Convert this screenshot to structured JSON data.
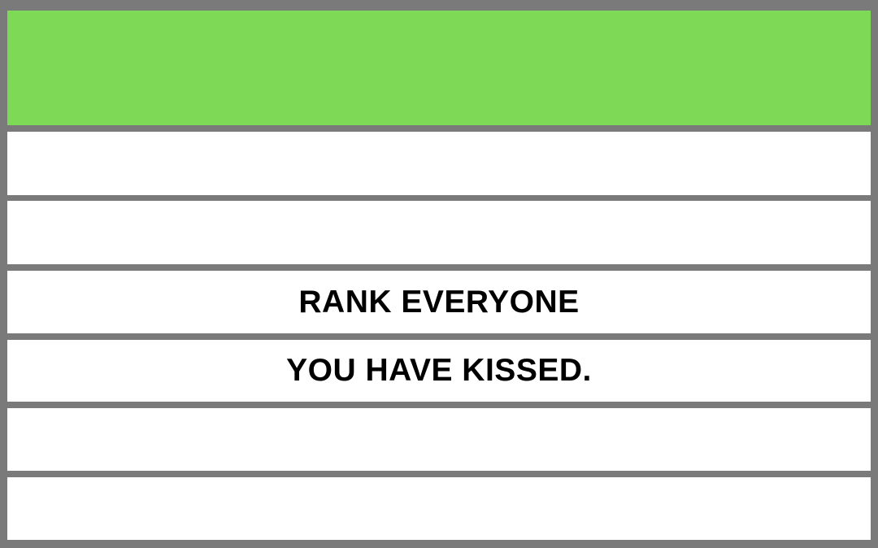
{
  "colors": {
    "border": "#7a7a7a",
    "header_fill": "#7ed957",
    "row_fill": "#ffffff",
    "text": "#000000"
  },
  "rows": [
    {
      "text": ""
    },
    {
      "text": ""
    },
    {
      "text": ""
    },
    {
      "text": "RANK EVERYONE"
    },
    {
      "text": "YOU HAVE KISSED."
    },
    {
      "text": ""
    },
    {
      "text": ""
    }
  ]
}
